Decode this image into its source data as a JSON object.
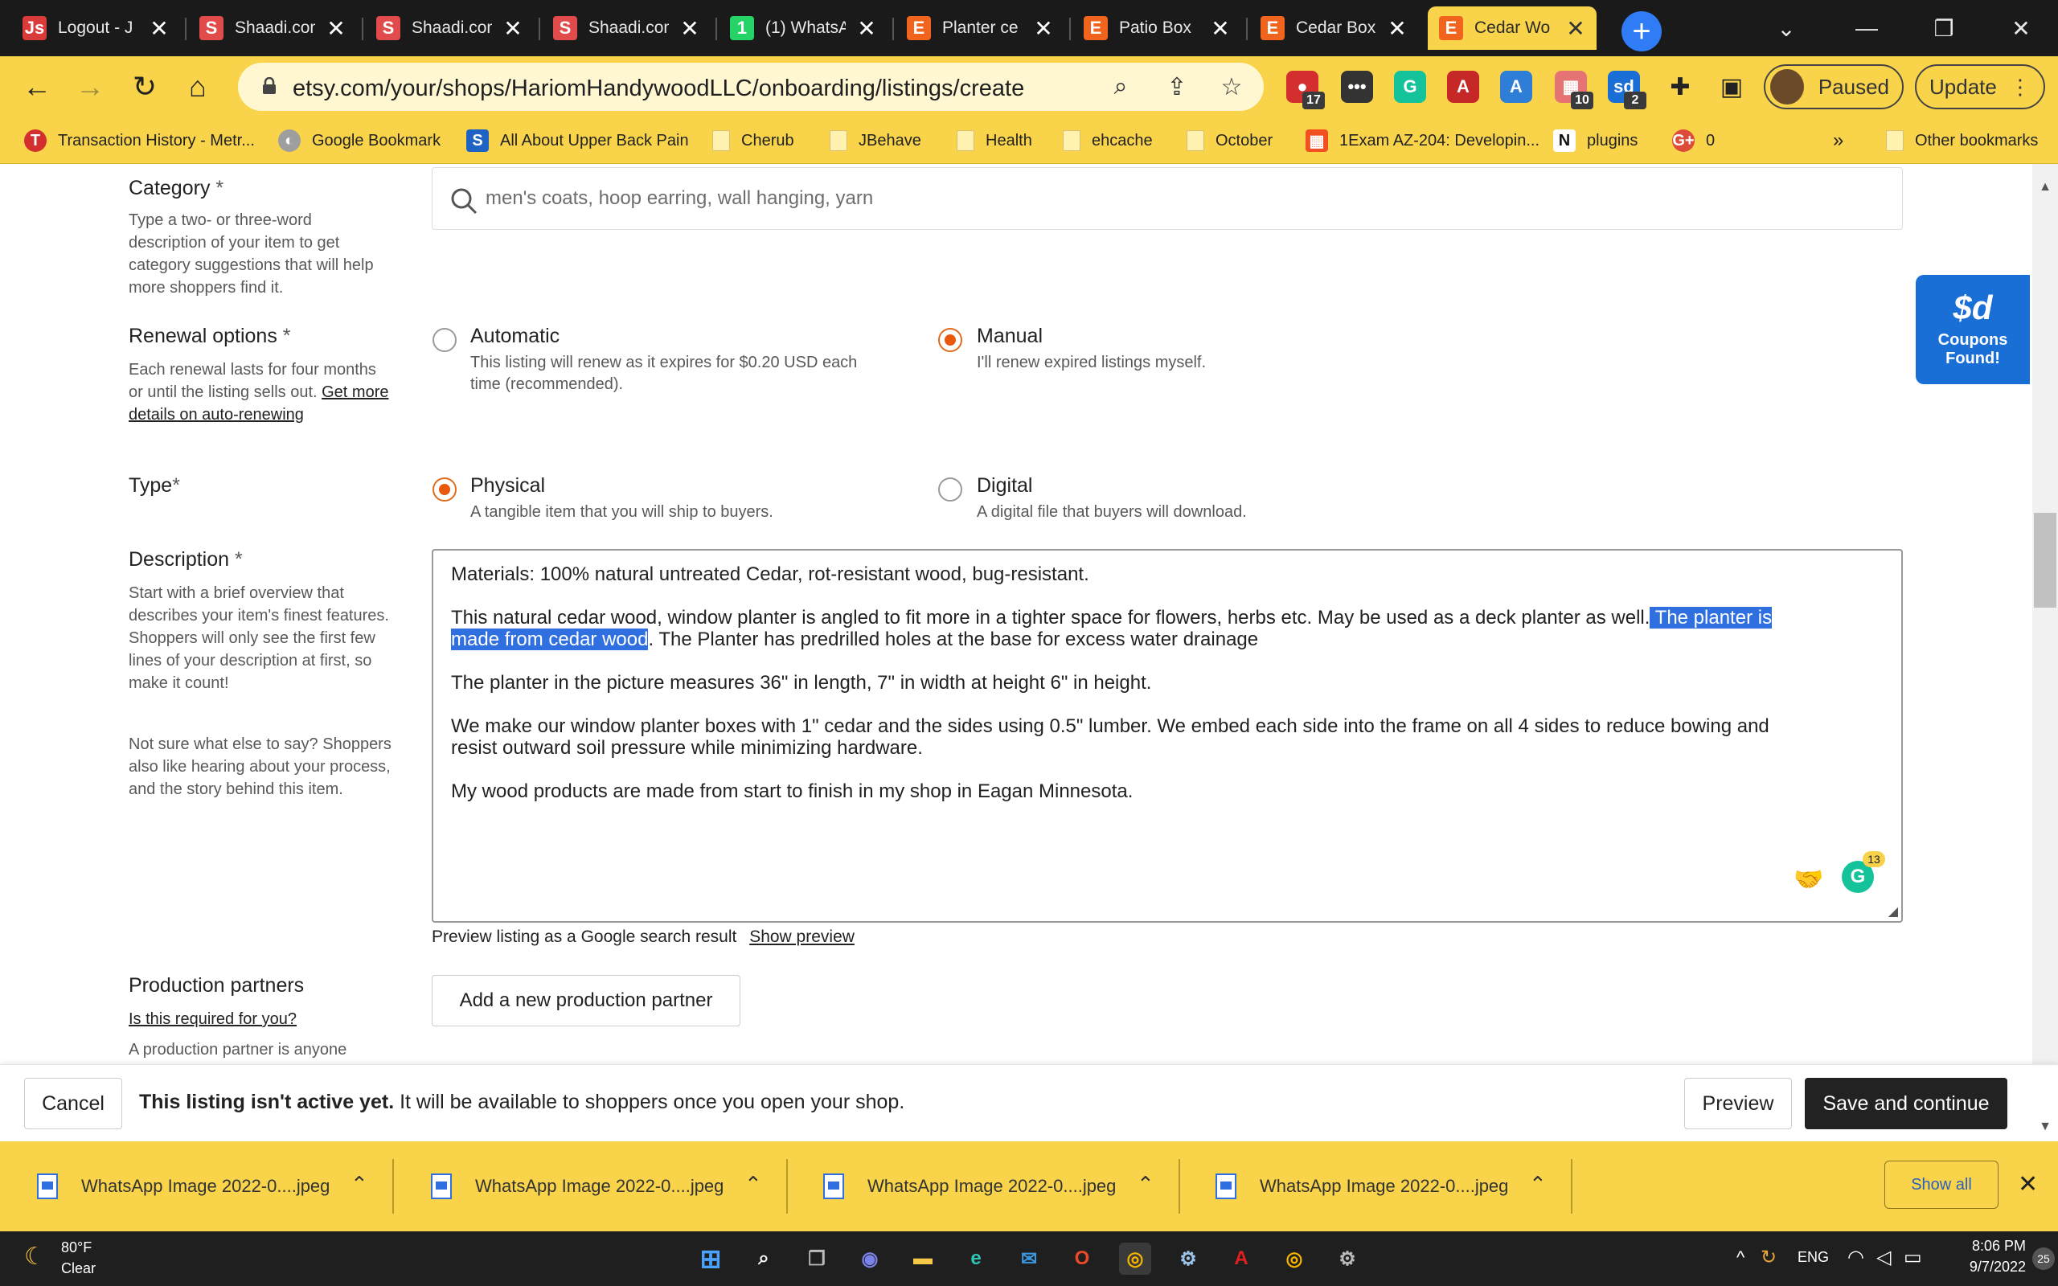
{
  "browser": {
    "tabs": [
      {
        "title": "Logout - J",
        "favicon": "js-logo-icon",
        "color": "#d93a3a",
        "glyph": "Js",
        "active": false
      },
      {
        "title": "Shaadi.com",
        "favicon": "shaadi-icon",
        "color": "#e14b4b",
        "glyph": "S",
        "active": false
      },
      {
        "title": "Shaadi.com",
        "favicon": "shaadi-icon",
        "color": "#e14b4b",
        "glyph": "S",
        "active": false
      },
      {
        "title": "Shaadi.com",
        "favicon": "shaadi-icon",
        "color": "#e14b4b",
        "glyph": "S",
        "active": false
      },
      {
        "title": "(1) WhatsA",
        "favicon": "whatsapp-icon",
        "color": "#25d366",
        "glyph": "1",
        "active": false
      },
      {
        "title": "Planter ce",
        "favicon": "etsy-icon",
        "color": "#f1641e",
        "glyph": "E",
        "active": false
      },
      {
        "title": "Patio Box",
        "favicon": "etsy-icon",
        "color": "#f1641e",
        "glyph": "E",
        "active": false
      },
      {
        "title": "Cedar Box",
        "favicon": "etsy-icon",
        "color": "#f1641e",
        "glyph": "E",
        "active": false
      },
      {
        "title": "Cedar Wo",
        "favicon": "etsy-icon",
        "color": "#f1641e",
        "glyph": "E",
        "active": true
      }
    ],
    "url": "etsy.com/your/shops/HariomHandywoodLLC/onboarding/listings/create",
    "profile_status": "Paused",
    "update_label": "Update",
    "extensions": [
      {
        "name": "extension-icon-red",
        "color": "#d32f2f",
        "glyph": "●",
        "badge": "17"
      },
      {
        "name": "extension-icon-dots",
        "color": "#333333",
        "glyph": "•••",
        "badge": ""
      },
      {
        "name": "grammarly-icon",
        "color": "#15c39a",
        "glyph": "G",
        "badge": ""
      },
      {
        "name": "acrobat-icon",
        "color": "#c62828",
        "glyph": "A",
        "badge": ""
      },
      {
        "name": "extension-icon-blue",
        "color": "#2e7dd7",
        "glyph": "A",
        "badge": ""
      },
      {
        "name": "extension-icon-calendar",
        "color": "#e57373",
        "glyph": "▦",
        "badge": "10"
      },
      {
        "name": "coupons-sd-icon",
        "color": "#1a6fd6",
        "glyph": "sd",
        "badge": "2"
      }
    ],
    "bookmarks": [
      {
        "label": "Transaction History - Metr...",
        "icon": "transit-icon",
        "color": "#d32f2f",
        "glyph": "T"
      },
      {
        "label": "Google Bookmark",
        "icon": "globe-icon",
        "color": "#9e9e9e",
        "glyph": "◐"
      },
      {
        "label": "All About Upper Back Pain",
        "icon": "s-site-icon",
        "color": "#1e63c4",
        "glyph": "S"
      },
      {
        "label": "Cherub",
        "icon": "folder-icon",
        "color": "",
        "glyph": ""
      },
      {
        "label": "JBehave",
        "icon": "folder-icon",
        "color": "",
        "glyph": ""
      },
      {
        "label": "Health",
        "icon": "folder-icon",
        "color": "",
        "glyph": ""
      },
      {
        "label": "ehcache",
        "icon": "folder-icon",
        "color": "",
        "glyph": ""
      },
      {
        "label": "October",
        "icon": "folder-icon",
        "color": "",
        "glyph": ""
      },
      {
        "label": "1Exam AZ-204: Developin...",
        "icon": "microsoft-icon",
        "color": "#f25022",
        "glyph": "▦"
      },
      {
        "label": "plugins",
        "icon": "notion-icon",
        "color": "#ffffff",
        "glyph": "N"
      },
      {
        "label": "0",
        "icon": "google-plus-icon",
        "color": "#dd4b39",
        "glyph": "G+"
      }
    ],
    "bookmarks_overflow": "»",
    "other_bookmarks": "Other bookmarks"
  },
  "form": {
    "category": {
      "label": "Category",
      "required_mark": "*",
      "help": "Type a two- or three-word description of your item to get category suggestions that will help more shoppers find it.",
      "placeholder": "men's coats, hoop earring, wall hanging, yarn"
    },
    "renewal": {
      "label": "Renewal options",
      "required_mark": "*",
      "help": "Each renewal lasts for four months or until the listing sells out.",
      "help_link": "Get more details on auto-renewing",
      "options": [
        {
          "title": "Automatic",
          "desc": "This listing will renew as it expires for $0.20 USD each time (recommended).",
          "selected": false
        },
        {
          "title": "Manual",
          "desc": "I'll renew expired listings myself.",
          "selected": true
        }
      ]
    },
    "type": {
      "label": "Type",
      "required_mark": "*",
      "options": [
        {
          "title": "Physical",
          "desc": "A tangible item that you will ship to buyers.",
          "selected": true
        },
        {
          "title": "Digital",
          "desc": "A digital file that buyers will download.",
          "selected": false
        }
      ]
    },
    "description": {
      "label": "Description",
      "required_mark": "*",
      "help1": "Start with a brief overview that describes your item's finest features. Shoppers will only see the first few lines of your description at first, so make it count!",
      "help2": "Not sure what else to say? Shoppers also like hearing about your process, and the story behind this item.",
      "line1": "Materials: 100% natural untreated Cedar, rot-resistant wood, bug-resistant.",
      "line2a": "This natural cedar wood, window planter is angled to fit more in a tighter space for flowers, herbs etc. May be used as a deck planter as well.",
      "line2_highlight": " The planter is ",
      "line3_highlight": "made from cedar wood",
      "line3b": ". The Planter has predrilled holes at the base for excess water drainage",
      "line4": "The planter in the picture measures 36\" in length, 7\" in width at height 6\" in height.",
      "line5": "We make our window planter boxes with 1\" cedar and the sides using 0.5\" lumber.  We embed each side into the frame on all 4 sides to reduce bowing and",
      "line6": "resist outward soil pressure while minimizing hardware.",
      "line7": "My wood products are made from start to finish in my shop in Eagan Minnesota.",
      "grammarly_count": "13"
    },
    "preview": {
      "text": "Preview listing as a Google search result",
      "link": "Show preview"
    },
    "production_partners": {
      "label": "Production partners",
      "link": "Is this required for you?",
      "help": "A production partner is anyone",
      "button": "Add a new production partner"
    }
  },
  "coupon_popup": {
    "logo": "$d",
    "text": "Coupons Found!"
  },
  "action_bar": {
    "cancel": "Cancel",
    "status_bold": "This listing isn't active yet.",
    "status_rest": "It will be available to shoppers once you open your shop.",
    "preview": "Preview",
    "save": "Save and continue"
  },
  "downloads": {
    "items": [
      {
        "name": "WhatsApp Image 2022-0....jpeg"
      },
      {
        "name": "WhatsApp Image 2022-0....jpeg"
      },
      {
        "name": "WhatsApp Image 2022-0....jpeg"
      },
      {
        "name": "WhatsApp Image 2022-0....jpeg"
      }
    ],
    "show_all": "Show all"
  },
  "taskbar": {
    "weather_temp": "80°F",
    "weather_desc": "Clear",
    "language": "ENG",
    "time": "8:06 PM",
    "date": "9/7/2022",
    "notification_count": "25"
  },
  "colors": {
    "theme_yellow": "#f9d44a",
    "etsy_orange": "#e8590c",
    "selection_blue": "#2f6fe0",
    "dark_button": "#222222"
  }
}
